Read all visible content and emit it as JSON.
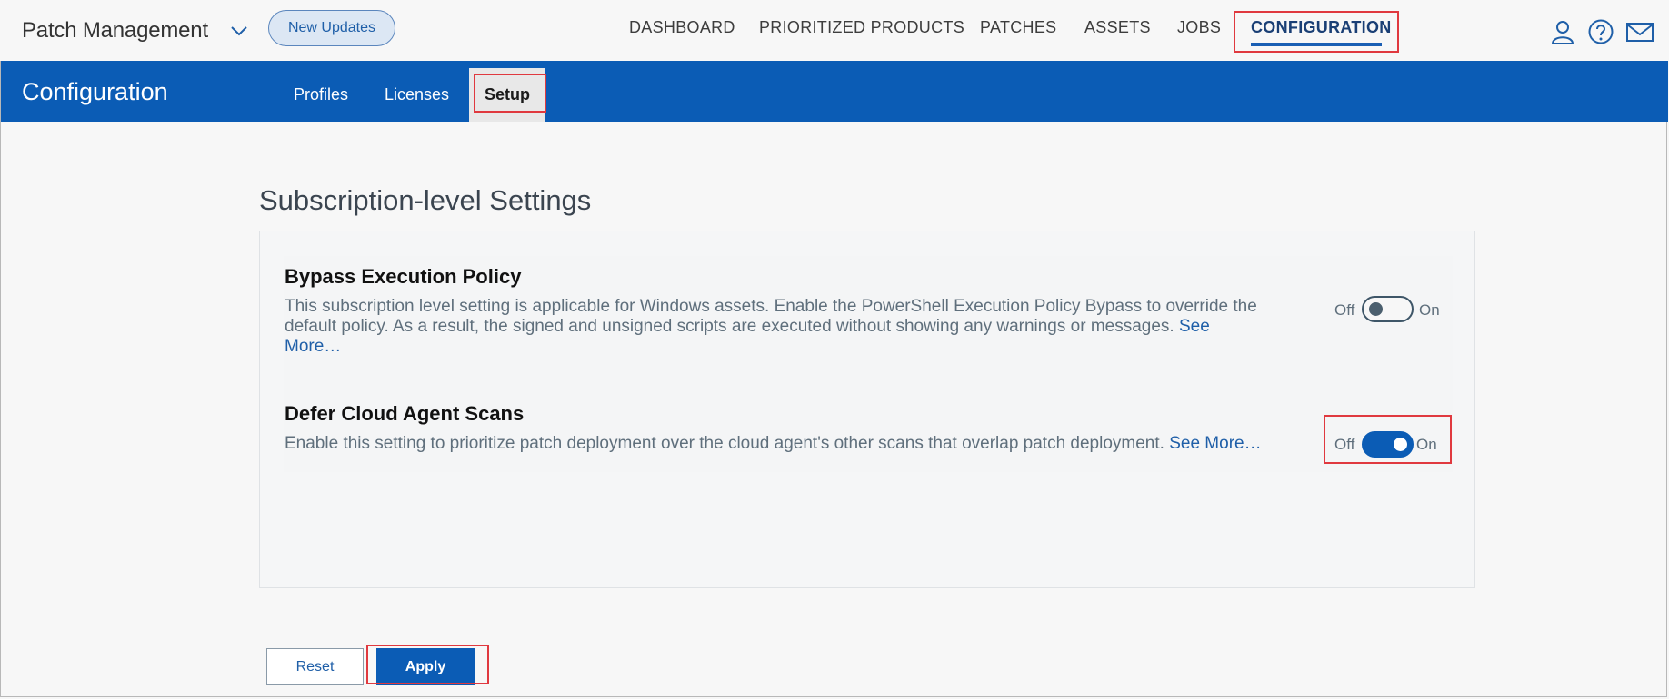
{
  "app": {
    "title": "Patch Management",
    "new_updates_label": "New Updates"
  },
  "nav": {
    "dashboard": "DASHBOARD",
    "prioritized_products": "PRIORITIZED PRODUCTS",
    "patches": "PATCHES",
    "assets": "ASSETS",
    "jobs": "JOBS",
    "configuration": "CONFIGURATION",
    "active": "CONFIGURATION"
  },
  "header_icons": [
    "user-icon",
    "help-icon",
    "mail-icon"
  ],
  "page": {
    "title": "Configuration",
    "subtabs": {
      "profiles": "Profiles",
      "licenses": "Licenses",
      "setup": "Setup"
    },
    "active_subtab": "Setup"
  },
  "section": {
    "title": "Subscription-level Settings",
    "settings": [
      {
        "title": "Bypass Execution Policy",
        "desc_line1": "This subscription level setting is applicable for Windows assets. Enable the PowerShell Execution Policy Bypass to override the",
        "desc_line2": "default policy. As a result, the signed and unsigned scripts are executed without showing any warnings or messages.",
        "see_more_a": "See",
        "see_more_b": "More…",
        "off_label": "Off",
        "on_label": "On",
        "enabled": false
      },
      {
        "title": "Defer Cloud Agent Scans",
        "desc": "Enable this setting to prioritize patch deployment over the cloud agent's other scans that overlap patch deployment.",
        "see_more": "See More…",
        "off_label": "Off",
        "on_label": "On",
        "enabled": true
      }
    ]
  },
  "buttons": {
    "reset": "Reset",
    "apply": "Apply"
  },
  "colors": {
    "brand_blue": "#0b5cb5",
    "highlight_red": "#e0393f",
    "link_blue": "#1f5fa8"
  }
}
